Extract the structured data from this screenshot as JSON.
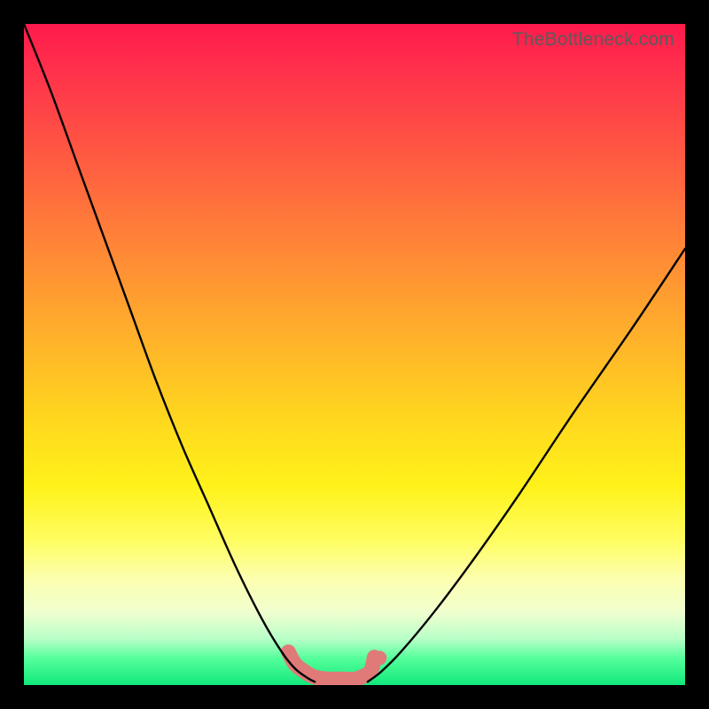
{
  "watermark": {
    "text": "TheBottleneck.com"
  },
  "chart_data": {
    "type": "line",
    "title": "",
    "xlabel": "",
    "ylabel": "",
    "xlim": [
      0,
      100
    ],
    "ylim": [
      0,
      100
    ],
    "series": [
      {
        "name": "left-curve",
        "x": [
          0,
          4,
          8,
          12,
          16,
          20,
          24,
          28,
          32,
          36,
          39,
          41,
          43,
          44
        ],
        "y": [
          100,
          90,
          79,
          68,
          57,
          46,
          36,
          27,
          18,
          10,
          5,
          2.5,
          1,
          0.5
        ]
      },
      {
        "name": "right-curve",
        "x": [
          52,
          54,
          57,
          62,
          68,
          75,
          83,
          92,
          100
        ],
        "y": [
          0.5,
          2,
          5,
          11,
          19,
          29,
          41,
          54,
          66
        ]
      },
      {
        "name": "flat-red-band",
        "x": [
          40,
          41,
          42.5,
          44,
          46,
          48,
          50,
          51.5,
          52.5,
          53
        ],
        "y": [
          5,
          3.2,
          2.0,
          1.2,
          0.9,
          0.9,
          0.9,
          1.4,
          2.2,
          4.2
        ]
      }
    ],
    "colors": {
      "curve": "#000000",
      "band": "#e07a78"
    },
    "background_gradient": [
      {
        "pos": 0.0,
        "color": "#ff1a4d"
      },
      {
        "pos": 0.5,
        "color": "#ffd020"
      },
      {
        "pos": 0.8,
        "color": "#fffd60"
      },
      {
        "pos": 1.0,
        "color": "#11e87c"
      }
    ]
  }
}
